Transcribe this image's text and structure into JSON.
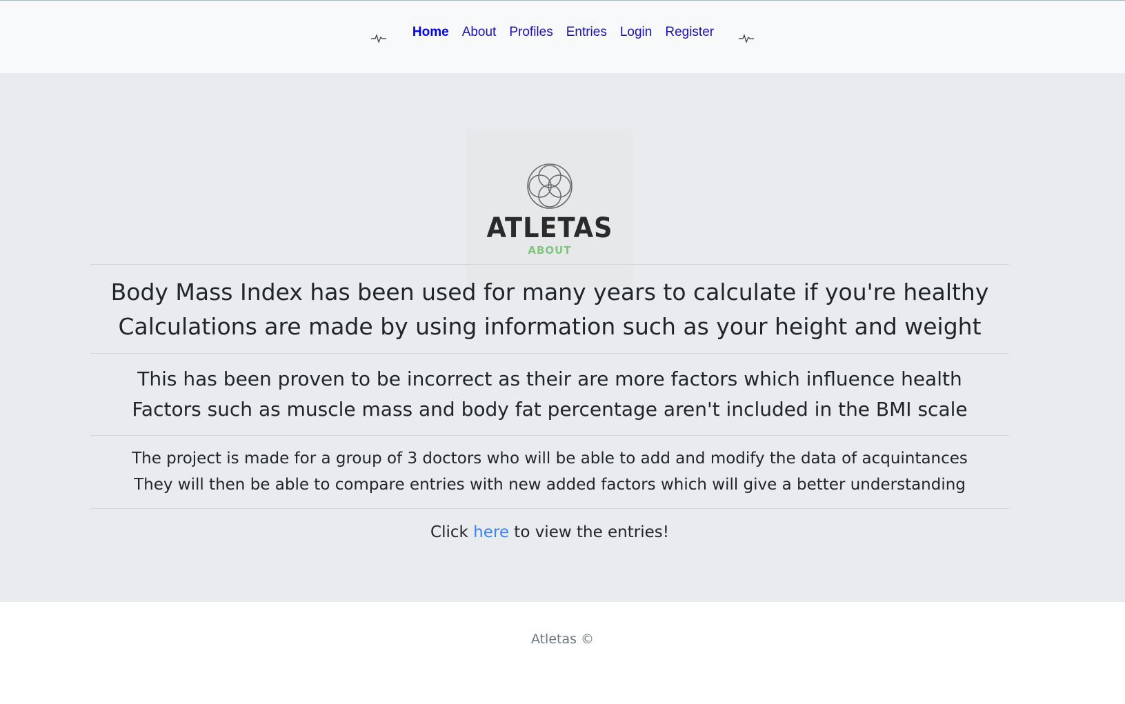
{
  "nav": {
    "items": [
      {
        "label": "Home",
        "active": true
      },
      {
        "label": "About",
        "active": false
      },
      {
        "label": "Profiles",
        "active": false
      },
      {
        "label": "Entries",
        "active": false
      },
      {
        "label": "Login",
        "active": false
      },
      {
        "label": "Register",
        "active": false
      }
    ],
    "left_icon": "pulse-icon",
    "right_icon": "pulse-icon"
  },
  "logo": {
    "wordmark": "ATLETAS",
    "subtitle": "ABOUT",
    "icon": "interlocking-rings-icon",
    "subtitle_color": "#7dc77a"
  },
  "content": {
    "heading_line1": "Body Mass Index has been used for many years to calculate if you're healthy",
    "heading_line2": "Calculations are made by using information such as your height and weight",
    "sub_line1": "This has been proven to be incorrect as their are more factors which influence health",
    "sub_line2": "Factors such as muscle mass and body fat percentage aren't included in the BMI scale",
    "info_line1": "The project is made for a group of 3 doctors who will be able to add and modify the data of acquintances",
    "info_line2": "They will then be able to compare entries with new added factors which will give a better understanding",
    "cta_prefix": "Click ",
    "cta_link": "here",
    "cta_suffix": " to view the entries!"
  },
  "footer": {
    "text": "Atletas ©"
  },
  "colors": {
    "nav_link": "#1a12b8",
    "link": "#3b82f6",
    "main_bg": "#e9ebee"
  }
}
